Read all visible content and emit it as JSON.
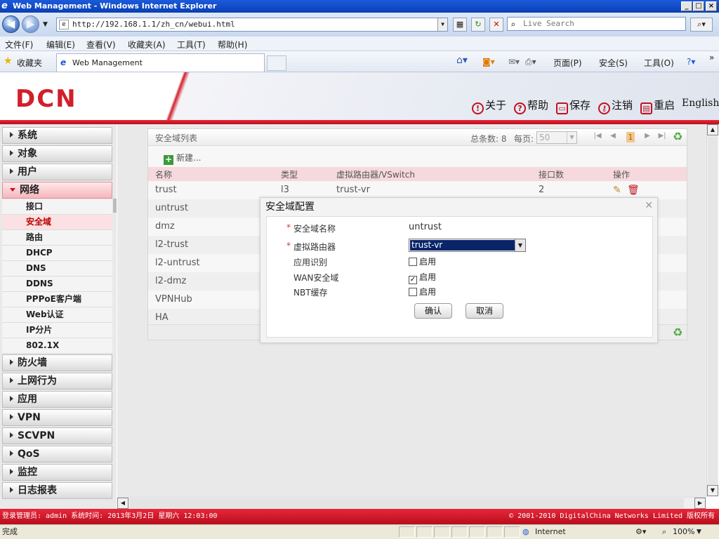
{
  "window": {
    "title": "Web Management - Windows Internet Explorer"
  },
  "browser": {
    "url": "http://192.168.1.1/zh_cn/webui.html",
    "search_placeholder": "Live Search",
    "menu": [
      "文件(F)",
      "编辑(E)",
      "查看(V)",
      "收藏夹(A)",
      "工具(T)",
      "帮助(H)"
    ],
    "favorites_label": "收藏夹",
    "tab_title": "Web Management",
    "toolbar": {
      "page": "页面(P)",
      "safety": "安全(S)",
      "tools": "工具(O)"
    },
    "status_done": "完成",
    "zone": "Internet",
    "zoom": "100%"
  },
  "brand": {
    "logo": "DCN",
    "accent": "#d21f2a"
  },
  "header_links": {
    "about": "关于",
    "help": "帮助",
    "save": "保存",
    "logout": "注销",
    "reboot": "重启",
    "language": "English"
  },
  "sidebar": {
    "top1": [
      "系统",
      "对象",
      "用户"
    ],
    "network": "网络",
    "network_items": [
      "接口",
      "安全域",
      "路由",
      "DHCP",
      "DNS",
      "DDNS",
      "PPPoE客户端",
      "Web认证",
      "IP分片",
      "802.1X"
    ],
    "top2": [
      "防火墙",
      "上网行为",
      "应用",
      "VPN",
      "SCVPN",
      "QoS",
      "监控",
      "日志报表"
    ]
  },
  "panel": {
    "title": "安全域列表",
    "total_label": "总条数: 8",
    "per_page_label": "每页:",
    "per_page": "50",
    "current_page": "1",
    "new_label": "新建...",
    "columns": [
      "名称",
      "类型",
      "虚拟路由器/VSwitch",
      "接口数",
      "操作"
    ],
    "rows": [
      {
        "name": "trust",
        "type": "l3",
        "vr": "trust-vr",
        "ifcount": "2"
      },
      {
        "name": "untrust"
      },
      {
        "name": "dmz"
      },
      {
        "name": "l2-trust"
      },
      {
        "name": "l2-untrust"
      },
      {
        "name": "l2-dmz"
      },
      {
        "name": "VPNHub"
      },
      {
        "name": "HA"
      }
    ]
  },
  "dialog": {
    "title": "安全域配置",
    "name_label": "安全域名称",
    "name_value": "untrust",
    "vr_label": "虚拟路由器",
    "vr_value": "trust-vr",
    "app_label": "应用识别",
    "app_enable": "启用",
    "app_checked": false,
    "wan_label": "WAN安全域",
    "wan_enable": "启用",
    "wan_checked": true,
    "nbt_label": "NBT缓存",
    "nbt_enable": "启用",
    "nbt_checked": false,
    "ok": "确认",
    "cancel": "取消"
  },
  "status": {
    "left": "登录管理员: admin 系统时间: 2013年3月2日 星期六 12:03:00",
    "right": "© 2001-2010 DigitalChina Networks Limited 版权所有"
  }
}
